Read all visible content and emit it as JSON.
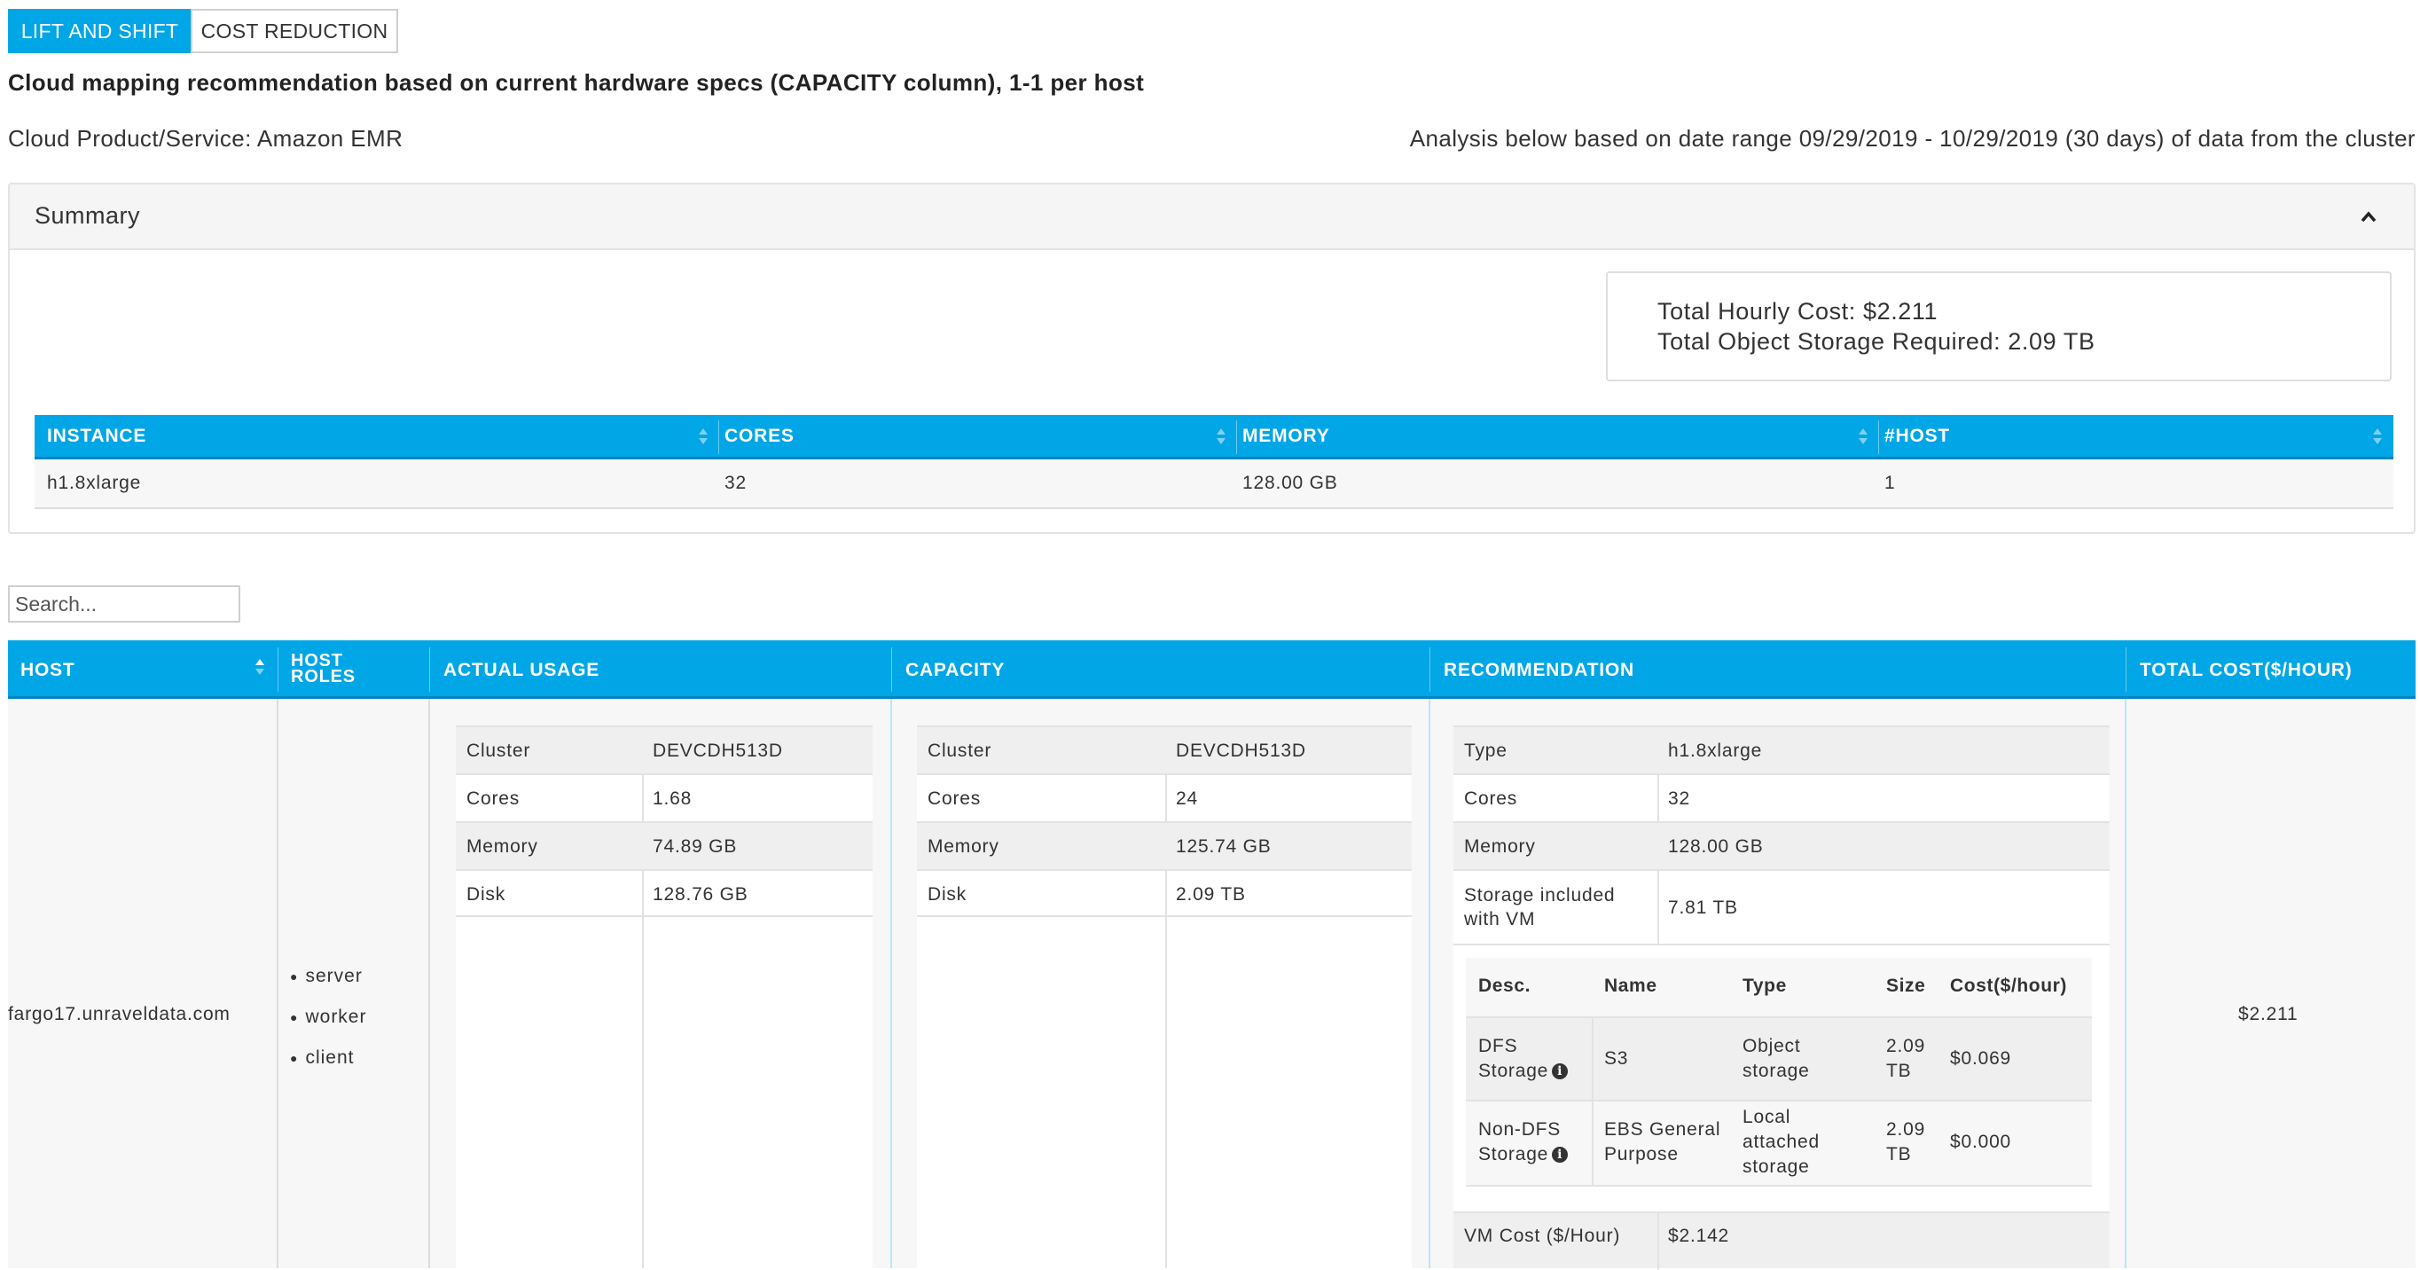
{
  "tabs": [
    {
      "label": "LIFT AND SHIFT",
      "active": true
    },
    {
      "label": "COST REDUCTION",
      "active": false
    }
  ],
  "heading": "Cloud mapping recommendation based on current hardware specs (CAPACITY column), 1-1 per host",
  "cloud_product": "Cloud Product/Service: Amazon EMR",
  "analysis_range": "Analysis below based on date range 09/29/2019 - 10/29/2019 (30 days) of data from the cluster",
  "summary": {
    "title": "Summary",
    "total_hourly_cost": "Total Hourly Cost: $2.211",
    "total_object_storage": "Total Object Storage Required: 2.09 TB",
    "columns": [
      "INSTANCE",
      "CORES",
      "MEMORY",
      "#HOST"
    ],
    "rows": [
      [
        "h1.8xlarge",
        "32",
        "128.00 GB",
        "1"
      ]
    ]
  },
  "search": {
    "placeholder": "Search..."
  },
  "main_table": {
    "columns": [
      "HOST",
      "HOST ROLES",
      "ACTUAL USAGE",
      "CAPACITY",
      "RECOMMENDATION",
      "TOTAL COST($/HOUR)"
    ],
    "row": {
      "host": "fargo17.unraveldata.com",
      "roles": [
        "server",
        "worker",
        "client"
      ],
      "actual_usage": [
        {
          "k": "Cluster",
          "v": "DEVCDH513D"
        },
        {
          "k": "Cores",
          "v": "1.68"
        },
        {
          "k": "Memory",
          "v": "74.89 GB"
        },
        {
          "k": "Disk",
          "v": "128.76 GB"
        }
      ],
      "capacity": [
        {
          "k": "Cluster",
          "v": "DEVCDH513D"
        },
        {
          "k": "Cores",
          "v": "24"
        },
        {
          "k": "Memory",
          "v": "125.74 GB"
        },
        {
          "k": "Disk",
          "v": "2.09 TB"
        }
      ],
      "recommendation": {
        "items": [
          {
            "k": "Type",
            "v": "h1.8xlarge"
          },
          {
            "k": "Cores",
            "v": "32"
          },
          {
            "k": "Memory",
            "v": "128.00 GB"
          },
          {
            "k": "Storage included with VM",
            "v": "7.81 TB"
          }
        ],
        "storage_columns": [
          "Desc.",
          "Name",
          "Type",
          "Size",
          "Cost($/hour)"
        ],
        "storage_rows": [
          {
            "desc": "DFS Storage",
            "name": "S3",
            "type": "Object storage",
            "size": "2.09 TB",
            "cost": "$0.069"
          },
          {
            "desc": "Non-DFS Storage",
            "name": "EBS General Purpose",
            "type": "Local attached storage",
            "size": "2.09 TB",
            "cost": "$0.000"
          }
        ],
        "vm_cost_label": "VM Cost ($/Hour)",
        "vm_cost_value": "$2.142"
      },
      "total_cost": "$2.211"
    }
  },
  "colors": {
    "accent": "#00a6e6",
    "header_border": "#0085c0"
  },
  "icons": [
    "chevron-up-icon",
    "sort-icon",
    "info-icon"
  ]
}
